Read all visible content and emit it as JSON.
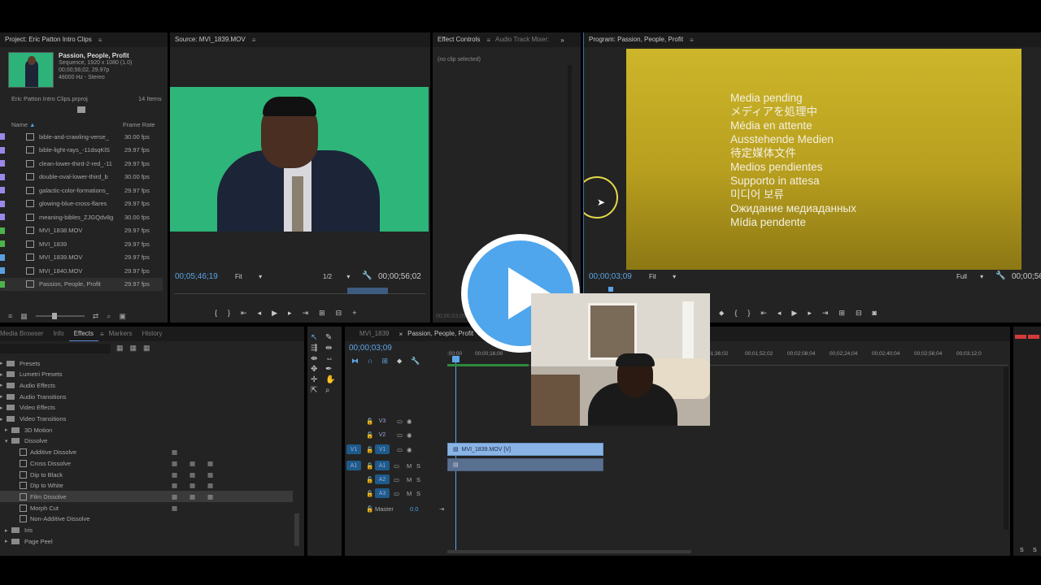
{
  "project": {
    "title": "Project: Eric Patton Intro Clips",
    "sequence_name": "Passion, People, Profit",
    "sequence_info": [
      "Sequence, 1920 x 1080 (1.0)",
      "00;00;56;02, 29.97p",
      "48000 Hz - Stereo"
    ],
    "file": "Eric Patton Intro Clips.prproj",
    "count": "14 Items",
    "col_name": "Name",
    "col_fps": "Frame Rate",
    "items": [
      {
        "name": "bible-and-crawling-verse_",
        "fps": "30.00 fps",
        "color": "#9b88e8"
      },
      {
        "name": "bible-light-rays_-11dsqKlS",
        "fps": "29.97 fps",
        "color": "#9b88e8"
      },
      {
        "name": "clean-lower-third-2-red_-11",
        "fps": "29.97 fps",
        "color": "#9b88e8"
      },
      {
        "name": "double-oval-lower-third_b",
        "fps": "30.00 fps",
        "color": "#9b88e8"
      },
      {
        "name": "galactic-color-formations_",
        "fps": "29.97 fps",
        "color": "#9b88e8"
      },
      {
        "name": "glowing-blue-cross-flares",
        "fps": "29.97 fps",
        "color": "#9b88e8"
      },
      {
        "name": "meaning-bibles_ZJGQdv8g",
        "fps": "30.00 fps",
        "color": "#9b88e8"
      },
      {
        "name": "MVI_1838.MOV",
        "fps": "29.97 fps",
        "color": "#4cb34c"
      },
      {
        "name": "MVI_1839",
        "fps": "29.97 fps",
        "color": "#4cb34c"
      },
      {
        "name": "MVI_1839.MOV",
        "fps": "29.97 fps",
        "color": "#5aa0e0"
      },
      {
        "name": "MVI_1840.MOV",
        "fps": "29.97 fps",
        "color": "#5aa0e0"
      },
      {
        "name": "Passion, People, Profit",
        "fps": "29.97 fps",
        "color": "#4cb34c"
      }
    ]
  },
  "source": {
    "title": "Source: MVI_1839.MOV",
    "timecode": "00;05;46;19",
    "fit": "Fit",
    "res": "1/2",
    "duration": "00;00;56;02"
  },
  "effect_controls": {
    "tab1": "Effect Controls",
    "tab2": "Audio Track Mixer:",
    "empty": "(no clip selected)",
    "tc": "00;00;03;09"
  },
  "program": {
    "title": "Program: Passion, People, Profit",
    "pending": [
      "Media pending",
      "メディアを処理中",
      "Média en attente",
      "Ausstehende Medien",
      "待定媒体文件",
      "Medios pendientes",
      "Supporto in attesa",
      "미디어 보류",
      "Ожидание медиаданных",
      "Mídia pendente"
    ],
    "timecode": "00;00;03;09",
    "fit": "Fit",
    "full": "Full",
    "duration": "00;00;56"
  },
  "effects": {
    "tabs": [
      "Media Browser",
      "Info",
      "Effects",
      "Markers",
      "History"
    ],
    "tree": [
      {
        "label": "Presets",
        "level": 0
      },
      {
        "label": "Lumetri Presets",
        "level": 0
      },
      {
        "label": "Audio Effects",
        "level": 0
      },
      {
        "label": "Audio Transitions",
        "level": 0
      },
      {
        "label": "Video Effects",
        "level": 0
      },
      {
        "label": "Video Transitions",
        "level": 0
      },
      {
        "label": "3D Motion",
        "level": 1
      },
      {
        "label": "Dissolve",
        "level": 1
      },
      {
        "label": "Additive Dissolve",
        "level": 2
      },
      {
        "label": "Cross Dissolve",
        "level": 2
      },
      {
        "label": "Dip to Black",
        "level": 2
      },
      {
        "label": "Dip to White",
        "level": 2
      },
      {
        "label": "Film Dissolve",
        "level": 2
      },
      {
        "label": "Morph Cut",
        "level": 2
      },
      {
        "label": "Non-Additive Dissolve",
        "level": 2
      },
      {
        "label": "Iris",
        "level": 1
      },
      {
        "label": "Page Peel",
        "level": 1
      }
    ]
  },
  "timeline": {
    "tab1": "MVI_1839",
    "tab2": "Passion, People, Profit",
    "timecode": "00;00;03;09",
    "ruler": [
      ";00;00",
      "00;00;16;00",
      "01;36;02",
      "00;01;52;02",
      "00;02;08;04",
      "00;02;24;04",
      "00;02;40;04",
      "00;02;56;04",
      "00;03;12;0"
    ],
    "tracks_video": [
      "V3",
      "V2",
      "V1"
    ],
    "tracks_audio": [
      "A1",
      "A2",
      "A3"
    ],
    "source_v": "V1",
    "source_a": "A1",
    "master": "Master",
    "master_val": "0.0",
    "clip_video": "MVI_1839.MOV [V]",
    "meter_vals": [
      "S",
      "S"
    ]
  }
}
